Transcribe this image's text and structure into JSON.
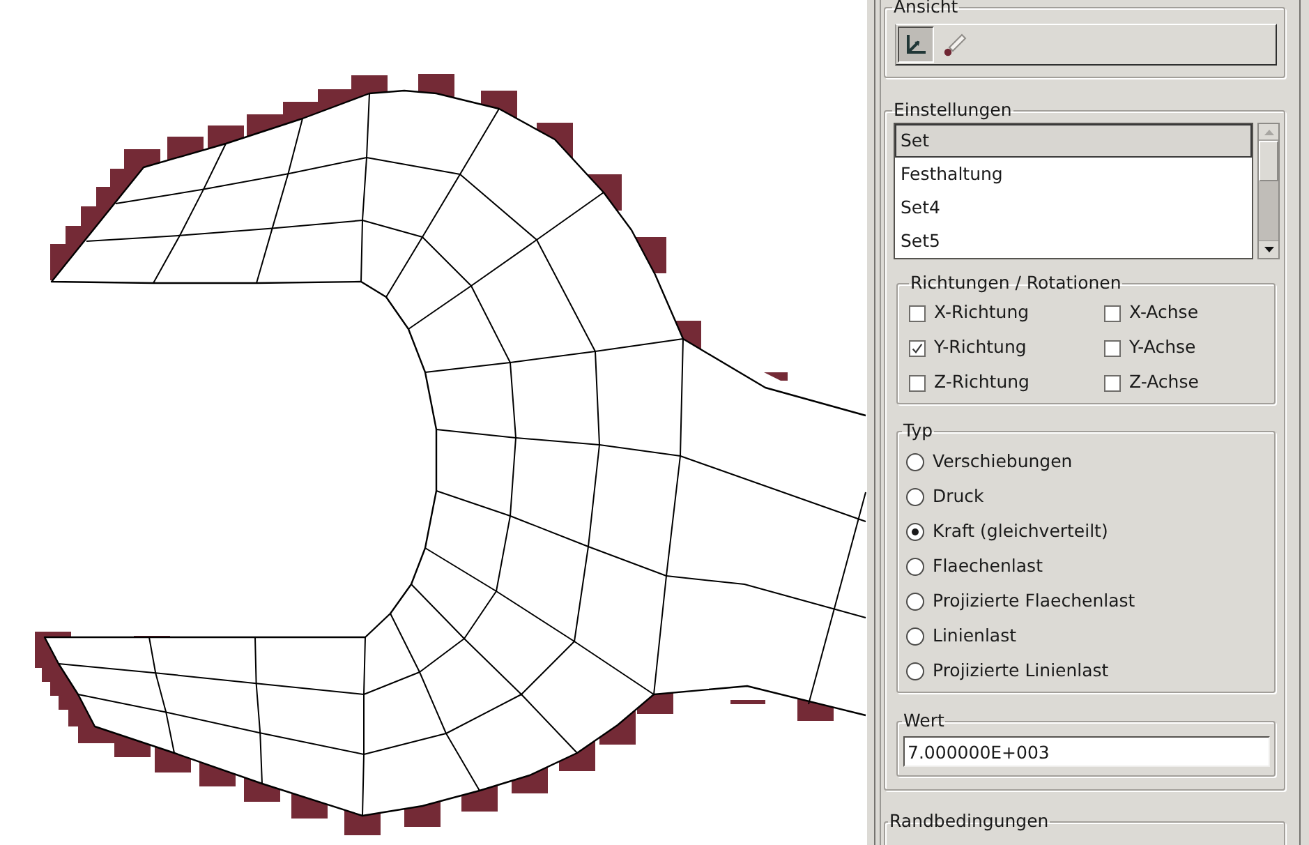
{
  "view_group": {
    "label": "Ansicht",
    "tools": [
      {
        "kind": "axes",
        "selected": true
      },
      {
        "kind": "brush",
        "selected": false
      }
    ]
  },
  "settings": {
    "label": "Einstellungen",
    "list": {
      "items": [
        {
          "label": "Set",
          "selected": true
        },
        {
          "label": "Festhaltung",
          "selected": false
        },
        {
          "label": "Set4",
          "selected": false
        },
        {
          "label": "Set5",
          "selected": false
        }
      ]
    },
    "directions": {
      "label": "Richtungen / Rotationen",
      "options": [
        {
          "label": "X-Richtung",
          "checked": false
        },
        {
          "label": "X-Achse",
          "checked": false
        },
        {
          "label": "Y-Richtung",
          "checked": true
        },
        {
          "label": "Y-Achse",
          "checked": false
        },
        {
          "label": "Z-Richtung",
          "checked": false
        },
        {
          "label": "Z-Achse",
          "checked": false
        }
      ]
    },
    "type": {
      "label": "Typ",
      "options": [
        {
          "label": "Verschiebungen",
          "selected": false
        },
        {
          "label": "Druck",
          "selected": false
        },
        {
          "label": "Kraft (gleichverteilt)",
          "selected": true
        },
        {
          "label": "Flaechenlast",
          "selected": false
        },
        {
          "label": "Projizierte Flaechenlast",
          "selected": false
        },
        {
          "label": "Linienlast",
          "selected": false
        },
        {
          "label": "Projizierte Linienlast",
          "selected": false
        }
      ]
    },
    "value": {
      "label": "Wert",
      "value": "7.000000E+003"
    }
  },
  "boundary_conditions": {
    "label": "Randbedingungen"
  }
}
